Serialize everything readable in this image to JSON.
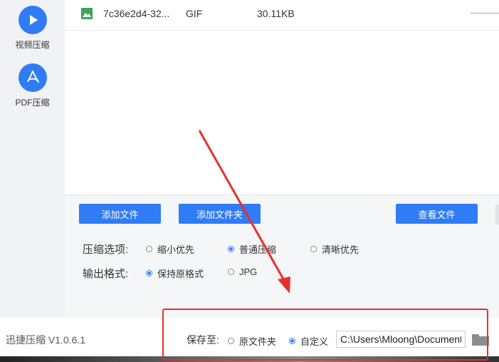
{
  "sidebar": {
    "items": [
      {
        "label": "视频压缩",
        "icon": "play-icon"
      },
      {
        "label": "PDF压缩",
        "icon": "pdf-icon"
      }
    ]
  },
  "file_list": {
    "rows": [
      {
        "name": "7c36e2d4-32...",
        "format": "GIF",
        "size": "30.11KB",
        "icon": "image-icon"
      }
    ]
  },
  "actions": {
    "add_file": "添加文件",
    "add_folder": "添加文件夹",
    "view_files": "查看文件"
  },
  "options": {
    "compress_label": "压缩选项:",
    "compress_choices": [
      {
        "label": "缩小优先",
        "selected": false
      },
      {
        "label": "普通压缩",
        "selected": true
      },
      {
        "label": "清晰优先",
        "selected": false
      }
    ],
    "format_label": "输出格式:",
    "format_choices": [
      {
        "label": "保持原格式",
        "selected": true
      },
      {
        "label": "JPG",
        "selected": false
      }
    ]
  },
  "footer": {
    "version": "迅捷压缩 V1.0.6.1",
    "save_to_label": "保存至:",
    "save_choices": [
      {
        "label": "原文件夹",
        "selected": false
      },
      {
        "label": "自定义",
        "selected": true
      }
    ],
    "save_path": "C:\\Users\\Mloong\\Documents"
  },
  "colors": {
    "accent": "#2f7cf6",
    "highlight_red": "#e8302a"
  }
}
